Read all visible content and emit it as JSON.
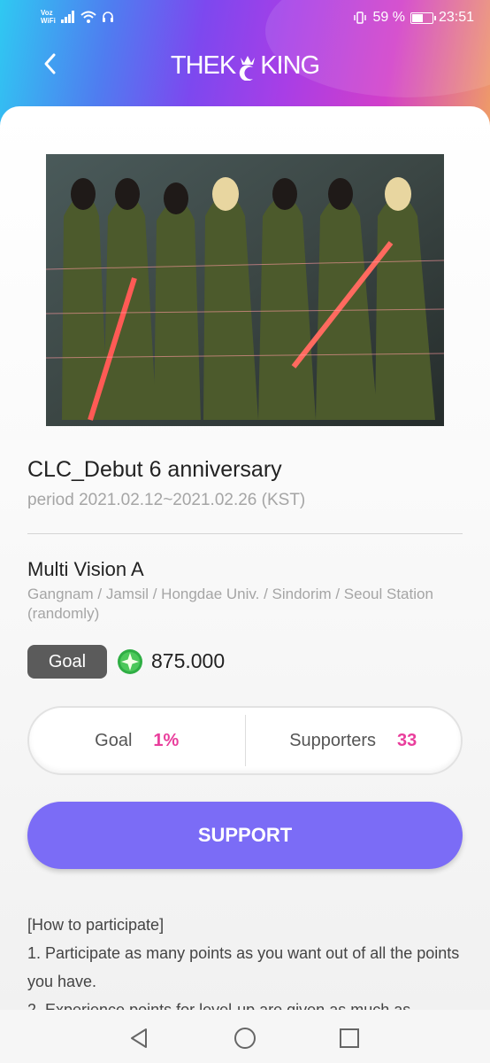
{
  "status_bar": {
    "network_line1": "Voz",
    "network_line2": "WiFi",
    "battery_percent": "59 %",
    "battery_level": 0.59,
    "time": "23:51"
  },
  "header": {
    "logo_left": "THEK",
    "logo_right": "KING"
  },
  "event": {
    "title": "CLC_Debut 6 anniversary",
    "period": "period 2021.02.12~2021.02.26 (KST)",
    "location_title": "Multi Vision A",
    "location_desc": "Gangnam / Jamsil / Hongdae Univ. / Sindorim / Seoul Station (randomly)",
    "goal_label": "Goal",
    "goal_amount": "875.000"
  },
  "stats": {
    "goal_label": "Goal",
    "goal_value": "1%",
    "supporters_label": "Supporters",
    "supporters_value": "33"
  },
  "support_button": "SUPPORT",
  "instructions": {
    "heading": "[How to participate]",
    "line1": "1. Participate as many points as you want out of all the points you have.",
    "line2": "2. Experience points for level-up are given as much as"
  },
  "colors": {
    "accent_pink": "#e93e9c",
    "support_button": "#7b6cf6",
    "goal_badge": "#5b5b5b"
  }
}
